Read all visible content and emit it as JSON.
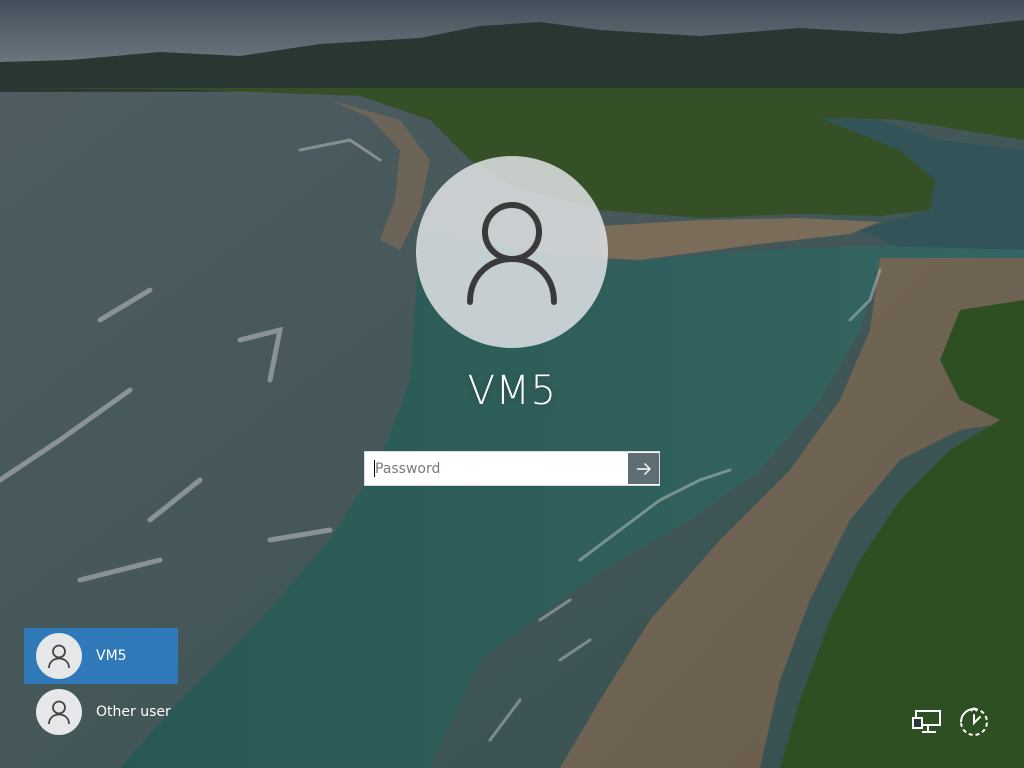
{
  "screen": {
    "type": "windows-lock-screen-login",
    "background": "aerial-beach-river-mouth-wallpaper"
  },
  "main_user": {
    "name": "VM5",
    "avatar_icon": "person-icon"
  },
  "password": {
    "placeholder": "Password",
    "value": "",
    "submit_icon": "arrow-right-icon"
  },
  "users": [
    {
      "name": "VM5",
      "selected": true,
      "avatar_icon": "person-icon"
    },
    {
      "name": "Other user",
      "selected": false,
      "avatar_icon": "person-icon"
    }
  ],
  "system_icons": [
    {
      "name": "network-icon"
    },
    {
      "name": "ease-of-access-icon"
    }
  ],
  "colors": {
    "selected_user_bg": "#2f79b9",
    "submit_button_bg": "#5e6e74",
    "avatar_circle": "#e0e3e5",
    "text": "#ffffff"
  }
}
